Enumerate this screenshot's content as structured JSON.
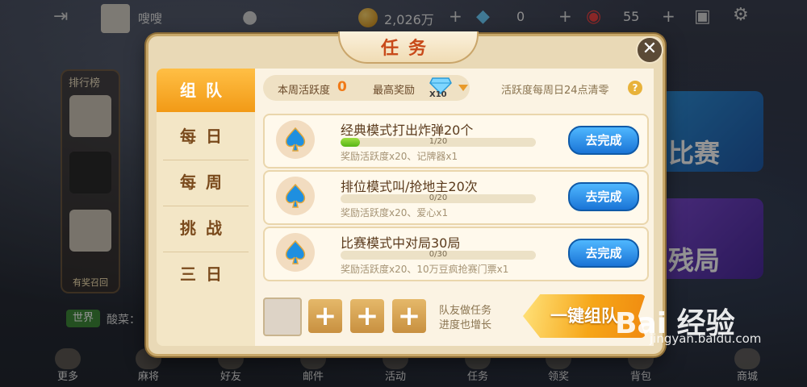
{
  "topbar": {
    "username": "嗖嗖",
    "coins": "2,026万",
    "diamonds": "0",
    "tickets": "55",
    "plus": "+"
  },
  "left_panel": {
    "title": "排行榜",
    "footer": "有奖召回"
  },
  "right_cards": {
    "match": "比赛",
    "endgame": "残局"
  },
  "chat": {
    "channel": "世界",
    "text": "酸菜："
  },
  "bottom_nav": [
    "更多",
    "麻将",
    "好友",
    "邮件",
    "活动",
    "任务",
    "领奖",
    "背包",
    "商城"
  ],
  "dialog": {
    "title": "任务",
    "close": "✕",
    "tabs": [
      "组队",
      "每日",
      "每周",
      "挑战",
      "三日"
    ],
    "active_tab": "组队",
    "week_activity_label": "本周活跃度",
    "week_activity_value": "0",
    "max_reward_label": "最高奖励",
    "max_reward_mult": "X10",
    "reset_note": "活跃度每周日24点清零",
    "help": "?",
    "tasks": [
      {
        "title": "经典模式打出炸弹20个",
        "progress": "1/20",
        "fraction": 0.05,
        "reward": "奖励活跃度x20、记牌器x1",
        "button": "去完成"
      },
      {
        "title": "排位模式叫/抢地主20次",
        "progress": "0/20",
        "fraction": 0.0,
        "reward": "奖励活跃度x20、爱心x1",
        "button": "去完成"
      },
      {
        "title": "比赛模式中对局30局",
        "progress": "0/30",
        "fraction": 0.0,
        "reward": "奖励活跃度x20、10万豆疯抢赛门票x1",
        "button": "去完成"
      }
    ],
    "team_note_line1": "队友做任务",
    "team_note_line2": "进度也增长",
    "add_symbol": "+",
    "team_button": "一键组队"
  },
  "watermark": {
    "brand": "Bai 经验",
    "url": "jingyan.baidu.com"
  },
  "colors": {
    "accent_orange": "#f29a16",
    "button_blue": "#1a74d6",
    "progress_green": "#57b515",
    "title_red": "#c84a1a"
  }
}
